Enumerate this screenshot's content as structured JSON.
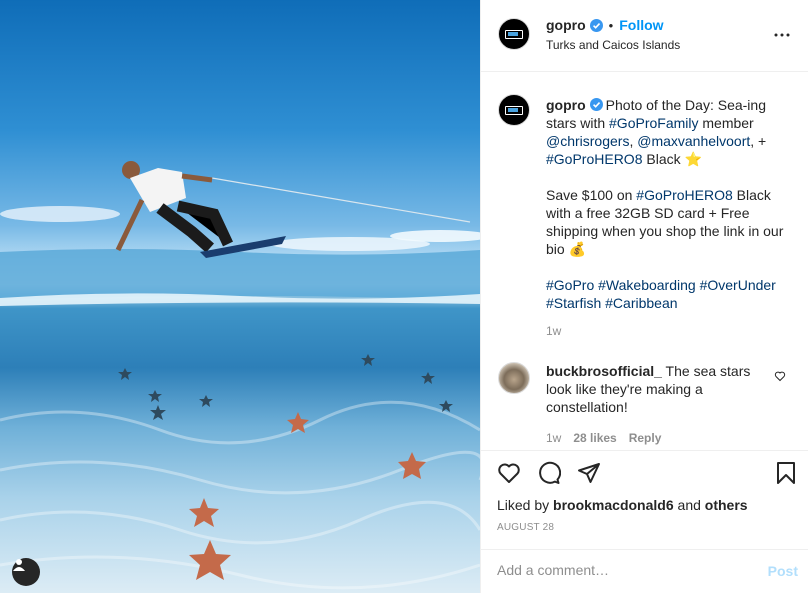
{
  "photo": {
    "alt_subject": "wakeboarder-over-starfish",
    "user_tag_icon": "user-icon"
  },
  "header": {
    "username": "gopro",
    "separator": "•",
    "follow_label": "Follow",
    "location": "Turks and Caicos Islands",
    "more_icon": "more-horizontal-icon"
  },
  "caption": {
    "username": "gopro",
    "lines": [
      {
        "text": "Photo of the Day: Sea-ing stars with "
      },
      {
        "tag": "#GoProFamily"
      },
      {
        "text": " member "
      },
      {
        "tag": "@chrisrogers"
      },
      {
        "text": ", "
      },
      {
        "tag": "@maxvanhelvoort"
      },
      {
        "text": ", + "
      },
      {
        "tag": "#GoProHERO8"
      },
      {
        "text": " Black "
      }
    ],
    "star_emoji": "⭐",
    "paragraph2_a": "Save $100 on ",
    "paragraph2_tag": "#GoProHERO8",
    "paragraph2_b": " Black with a free 32GB SD card + Free shipping when you shop the link in our bio ",
    "bag_emoji": "💰",
    "hashtags": [
      "#GoPro",
      "#Wakeboarding",
      "#OverUnder",
      "#Starfish",
      "#Caribbean"
    ],
    "time": "1w"
  },
  "comment": {
    "username": "buckbrosofficial_",
    "text": " The sea stars look like they're making a constellation!",
    "time": "1w",
    "likes": "28 likes",
    "reply_label": "Reply"
  },
  "actions": {
    "icons": [
      "heart-icon",
      "comment-icon",
      "share-icon",
      "save-icon"
    ],
    "liked_by_prefix": "Liked by ",
    "liked_by_user": "brookmacdonald6",
    "liked_by_and": " and ",
    "liked_by_others": "others",
    "date": "AUGUST 28"
  },
  "add_comment": {
    "placeholder": "Add a comment…",
    "post_label": "Post"
  },
  "colors": {
    "link": "#00376b",
    "accent": "#0095f6",
    "post_disabled": "#b2dffc",
    "verified": "#3897f0"
  }
}
